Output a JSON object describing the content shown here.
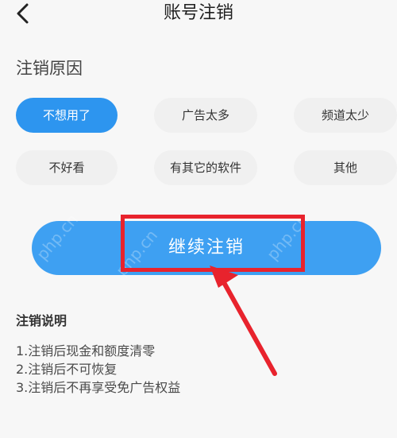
{
  "header": {
    "title": "账号注销",
    "back_icon": "chevron-left-icon"
  },
  "reasons": {
    "title": "注销原因",
    "options": [
      {
        "label": "不想用了",
        "selected": true
      },
      {
        "label": "广告太多",
        "selected": false
      },
      {
        "label": "频道太少",
        "selected": false
      },
      {
        "label": "不好看",
        "selected": false
      },
      {
        "label": "有其它的软件",
        "selected": false
      },
      {
        "label": "其他",
        "selected": false
      }
    ]
  },
  "action": {
    "continue_label": "继续注销"
  },
  "notes": {
    "title": "注销说明",
    "items": [
      "1.注销后现金和额度清零",
      "2.注销后不可恢复",
      "3.注销后不再享受免广告权益"
    ]
  },
  "watermark": {
    "text": "php.cn"
  },
  "colors": {
    "accent": "#3ea0f2",
    "selected_chip": "#2d95ef",
    "chip_bg": "#f0f0f0",
    "highlight": "#e8232d",
    "background": "#f7f7f7"
  }
}
